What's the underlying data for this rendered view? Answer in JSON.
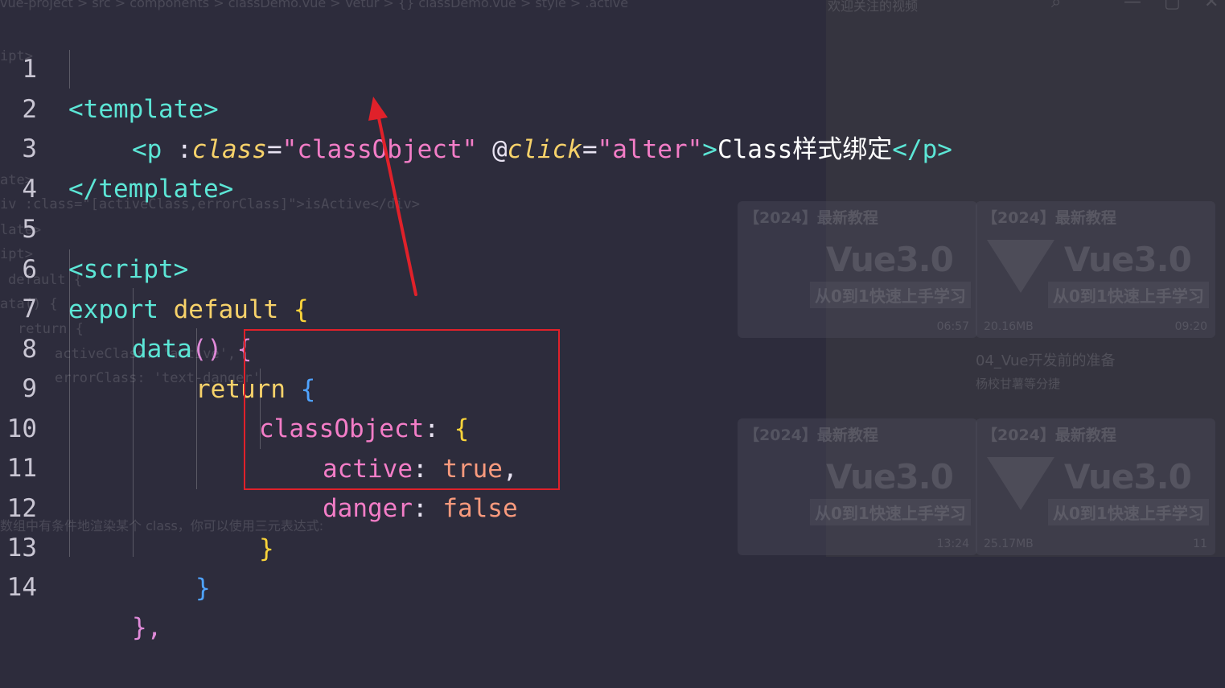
{
  "background": {
    "breadcrumb": "vue-project > src > components > classDemo.vue > Vetur > {} classDemo.vue > style > .active",
    "right_header_text": "欢迎关注的视频",
    "ghost_code_lines": [
      "ipt>",
      "ate>",
      "iv :class=\"[activeClass,errorClass]\">isActive</div>",
      "late>",
      "ipt>",
      "default {",
      "ata() {",
      "return {",
      "activeClass: 'active',",
      "errorClass: 'text-danger'"
    ],
    "ghost_note": "数组中有条件地渲染某个 class，你可以使用三元表达式:",
    "video_cards": [
      {
        "title": "【2024】最新教程",
        "big": "Vue3.0",
        "subtitle": "从0到1快速上手学习",
        "size": "",
        "duration": "06:57"
      },
      {
        "title": "【2024】最新教程",
        "big": "Vue3.0",
        "subtitle": "从0到1快速上手学习",
        "size": "20.16MB",
        "duration": "09:20"
      },
      {
        "title": "【2024】最新教程",
        "big": "Vue3.0",
        "subtitle": "从0到1快速上手学习",
        "size": "",
        "duration": "13:24"
      },
      {
        "title": "【2024】最新教程",
        "big": "Vue3.0",
        "subtitle": "从0到1快速上手学习",
        "size": "25.17MB",
        "duration": "11"
      }
    ],
    "video_caption": "04_Vue开发前的准备",
    "video_channel": "杨校甘薯等分捷"
  },
  "editor": {
    "line_numbers": [
      "1",
      "2",
      "3",
      "4",
      "5",
      "6",
      "7",
      "8",
      "9",
      "10",
      "11",
      "12",
      "13",
      "14"
    ],
    "line1": {
      "open": "<template>"
    },
    "line2": {
      "tag_open": "<p",
      "bind_prefix": " :",
      "attr1": "class",
      "eq1": "=",
      "val1": "\"classObject\"",
      "at": " @",
      "attr2": "click",
      "eq2": "=",
      "val2": "\"alter\"",
      "gt": ">",
      "content": "Class样式绑定",
      "tag_close": "</p>"
    },
    "line3": {
      "close": "</template>"
    },
    "line5": {
      "open": "<script>"
    },
    "line6": {
      "export": "export",
      "default": " default ",
      "brace": "{"
    },
    "line7": {
      "fn": "data",
      "parens": "()",
      "brace": " {"
    },
    "line8": {
      "ret": "return",
      "brace": " {"
    },
    "line9": {
      "key": "classObject",
      "colon": ": ",
      "brace": "{"
    },
    "line10": {
      "key": "active",
      "colon": ": ",
      "val": "true",
      "comma": ","
    },
    "line11": {
      "key": "danger",
      "colon": ": ",
      "val": "false"
    },
    "line12": {
      "brace": "}"
    },
    "line13": {
      "brace": "}"
    },
    "line14": {
      "brace": "},"
    }
  },
  "annotation": {
    "box_color": "#e0212a",
    "arrow_color": "#e0212a"
  }
}
